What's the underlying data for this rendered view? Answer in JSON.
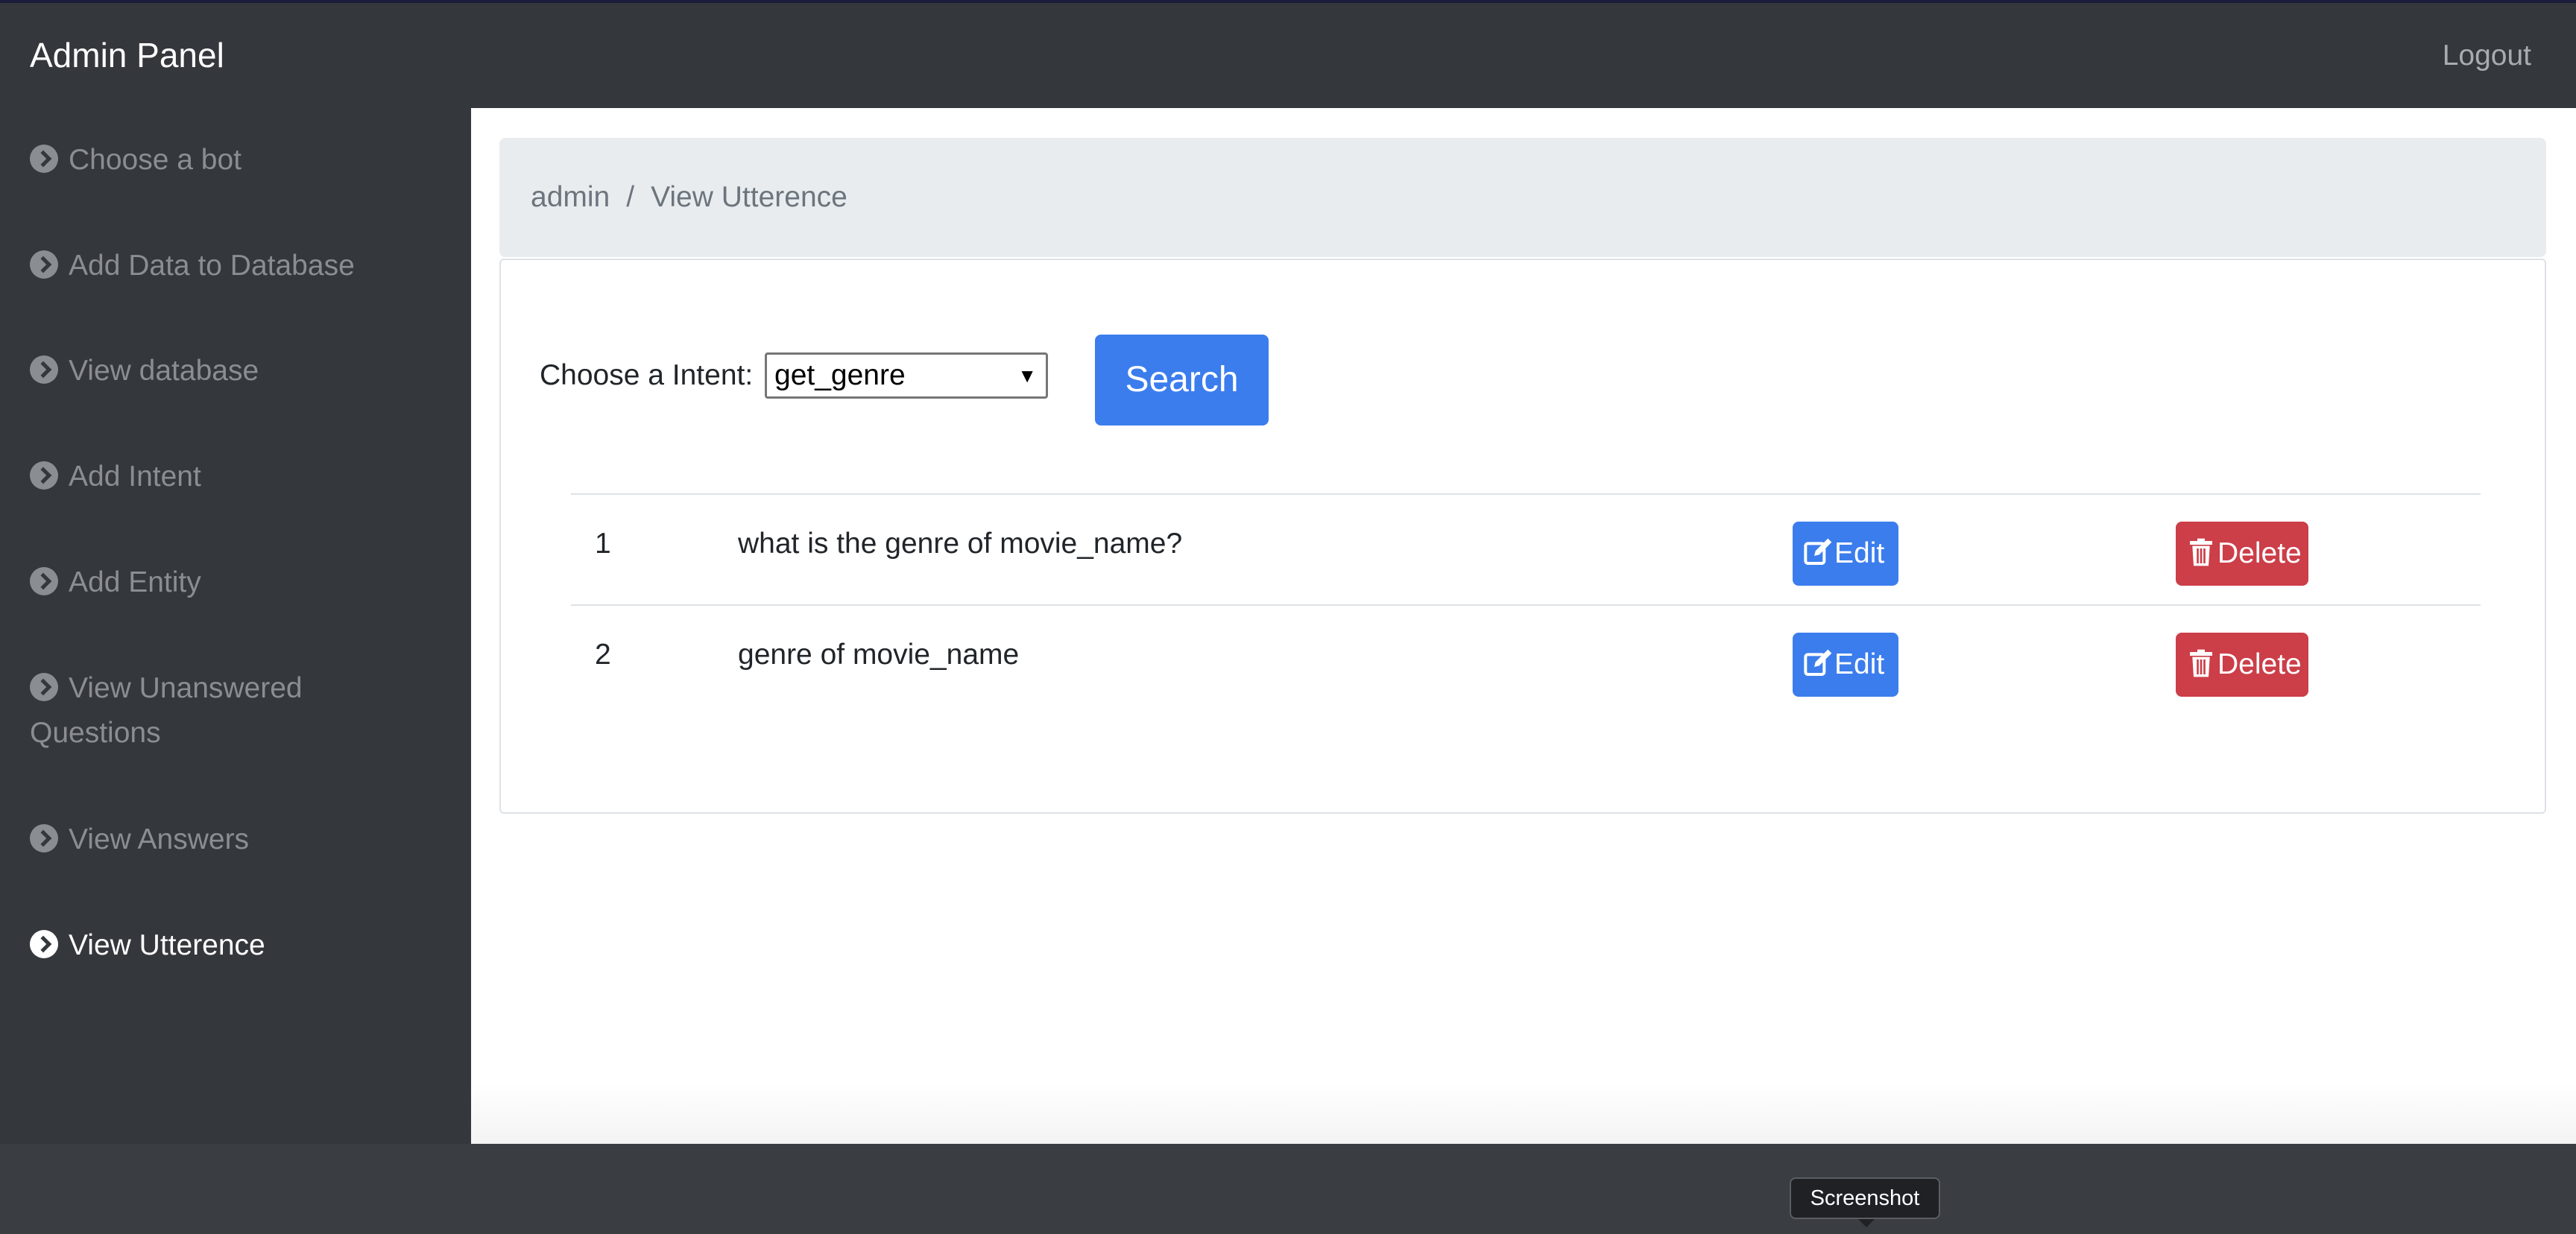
{
  "header": {
    "brand": "Admin Panel",
    "logout_label": "Logout"
  },
  "sidebar": {
    "items": [
      {
        "label": "Choose a bot",
        "icon": "chevron-circle-right-icon",
        "active": false
      },
      {
        "label": "Add Data to Database",
        "icon": "chevron-circle-right-icon",
        "active": false
      },
      {
        "label": "View database",
        "icon": "chevron-circle-right-icon",
        "active": false
      },
      {
        "label": "Add Intent",
        "icon": "chevron-circle-right-icon",
        "active": false
      },
      {
        "label": "Add Entity",
        "icon": "chevron-circle-right-icon",
        "active": false
      },
      {
        "label": "View Unanswered",
        "label_line2": "Questions",
        "icon": "chevron-circle-right-icon",
        "active": false
      },
      {
        "label": "View Answers",
        "icon": "chevron-circle-right-icon",
        "active": false
      },
      {
        "label": "View Utterence",
        "icon": "chevron-circle-right-icon",
        "active": true
      }
    ]
  },
  "breadcrumb": {
    "items": [
      "admin",
      "View Utterence"
    ],
    "separator": "/"
  },
  "filter": {
    "label": "Choose a Intent:",
    "selected_value": "get_genre",
    "search_label": "Search"
  },
  "table": {
    "rows": [
      {
        "index": "1",
        "utterance": "what is the genre of movie_name?",
        "edit_label": "Edit",
        "delete_label": "Delete"
      },
      {
        "index": "2",
        "utterance": "genre of movie_name",
        "edit_label": "Edit",
        "delete_label": "Delete"
      }
    ]
  },
  "taskbar": {
    "tooltip": "Screenshot"
  },
  "colors": {
    "primary": "#3b7ded",
    "danger": "#cc3e48",
    "sidebar_bg": "#34373c",
    "breadcrumb_bg": "#e9ecef"
  }
}
